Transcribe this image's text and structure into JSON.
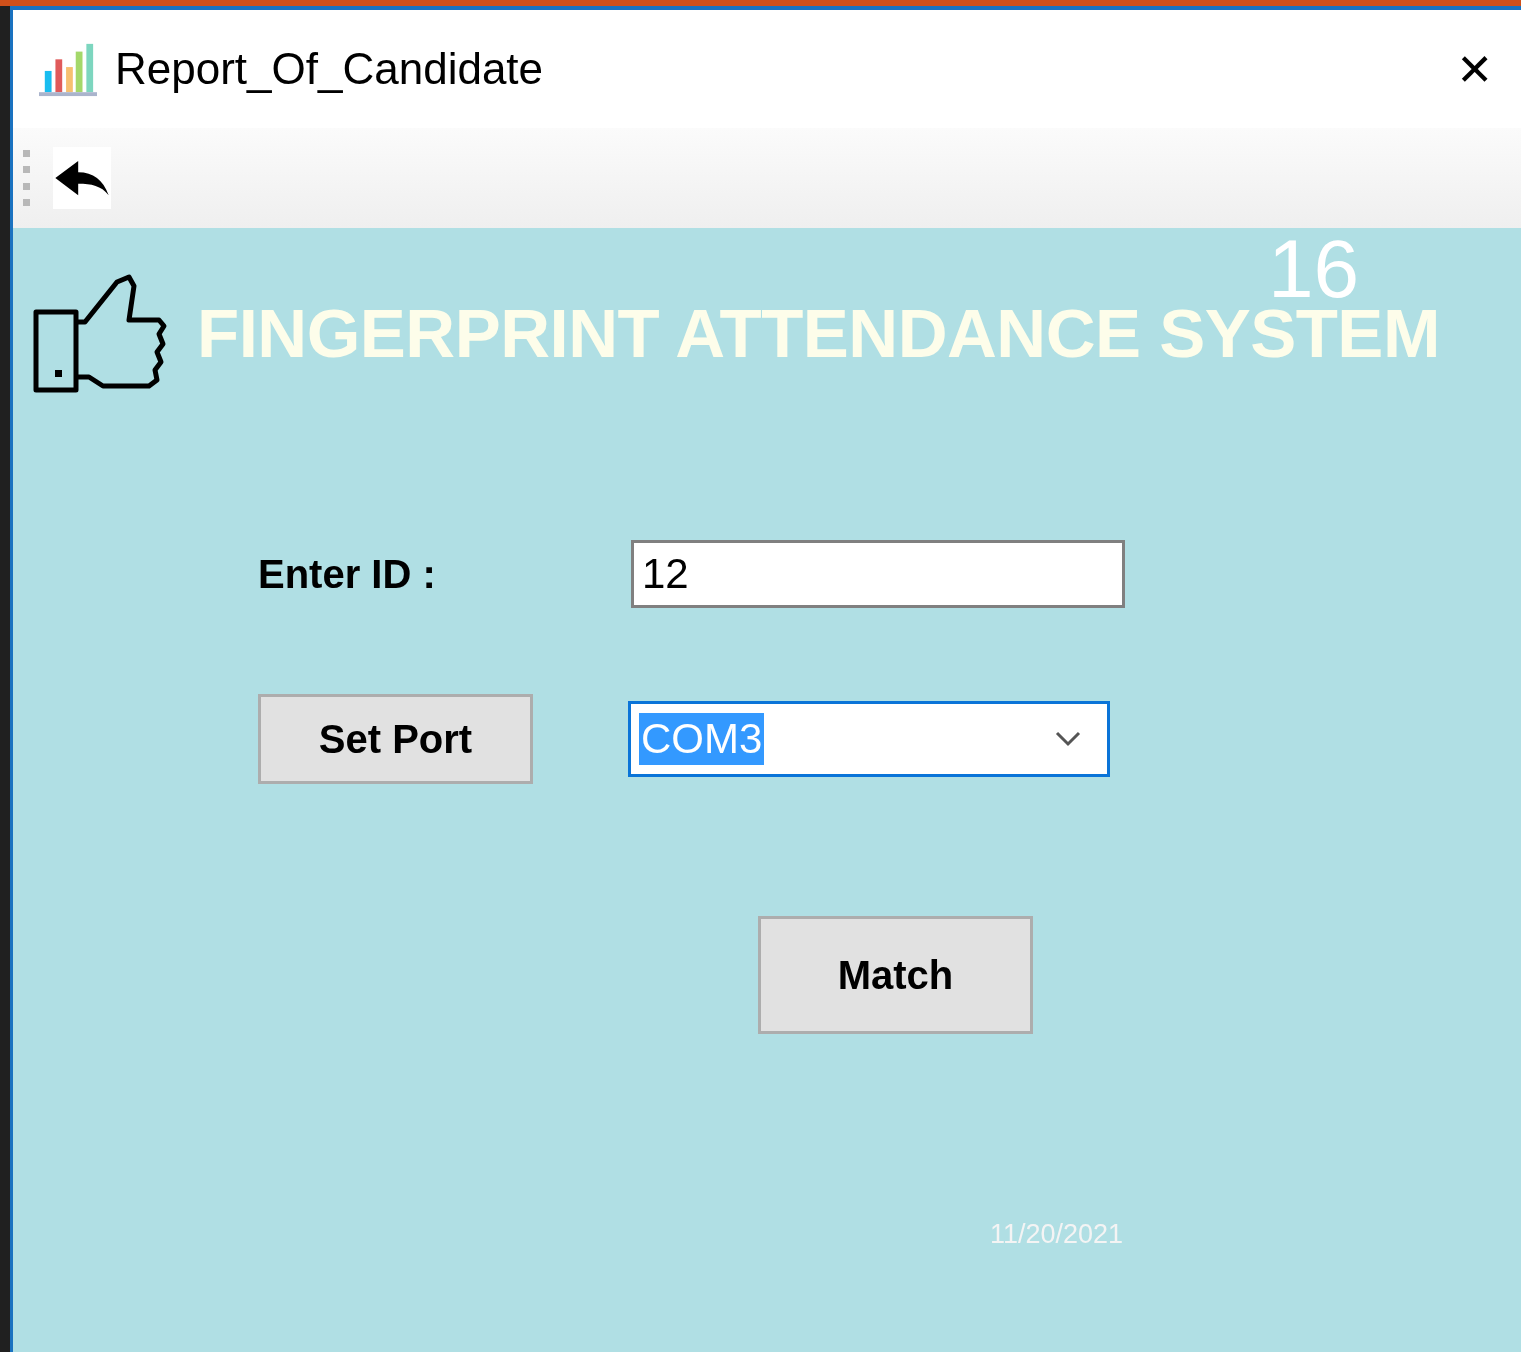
{
  "window": {
    "title": "Report_Of_Candidate",
    "close": "✕"
  },
  "toolbar": {
    "back_button": {
      "disabled": false
    }
  },
  "counter": "16",
  "heading": "FINGERPRINT ATTENDANCE SYSTEM",
  "form": {
    "id_label": "Enter ID :",
    "id_value": "12",
    "set_port_button": "Set Port",
    "port": {
      "value": "COM3",
      "focused": true,
      "text_selected": true
    },
    "match_button": "Match"
  },
  "date": "11/20/2021"
}
